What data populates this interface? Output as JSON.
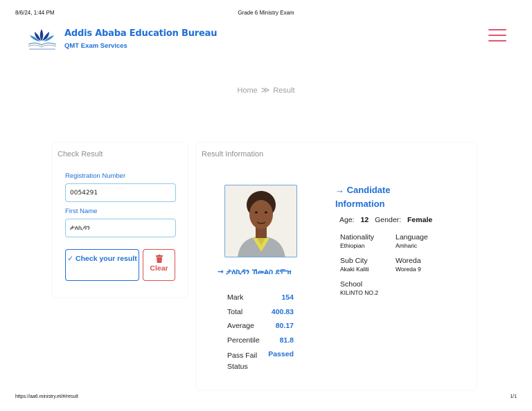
{
  "print": {
    "date": "8/6/24, 1:44 PM",
    "title": "Grade 6 Ministry Exam",
    "url": "https://aa6.ministry.et/#/result",
    "page": "1/1"
  },
  "brand": {
    "name": "Addis Ababa Education Bureau",
    "subtitle": "QMT Exam Services",
    "color": "#1f6fd6"
  },
  "breadcrumb": {
    "home": "Home",
    "separator": "≫",
    "current": "Result"
  },
  "check_result": {
    "title": "Check Result",
    "registration_label": "Registration Number",
    "registration_value": "0054291",
    "first_name_label": "First Name",
    "first_name_value": "ታለኪዳን",
    "check_button": "Check your result",
    "check_icon": "✓",
    "clear_button": "Clear",
    "clear_icon": "trash-icon"
  },
  "result": {
    "title": "Result Information",
    "candidate_name": "→ ታለኪዳን ኸመልስ ደሞዝ",
    "stats": [
      {
        "label": "Mark",
        "value": "154"
      },
      {
        "label": "Total",
        "value": "400.83"
      },
      {
        "label": "Average",
        "value": "80.17"
      },
      {
        "label": "Percentile",
        "value": "81.8"
      },
      {
        "label": "Pass Fail Status",
        "value": "Passed"
      }
    ]
  },
  "candidate_info": {
    "title": "→ Candidate Information",
    "age_label": "Age:",
    "age_value": "12",
    "gender_label": "Gender:",
    "gender_value": "Female",
    "nationality_label": "Nationality",
    "nationality_value": "Ethiopian",
    "language_label": "Language",
    "language_value": "Amharic",
    "subcity_label": "Sub City",
    "subcity_value": "Akaki Kaliti",
    "woreda_label": "Woreda",
    "woreda_value": "Woreda 9",
    "school_label": "School",
    "school_value": "KILINTO NO.2"
  },
  "colors": {
    "accent": "#1f6fd6",
    "hamburger": "#e05570",
    "danger": "#d9534f",
    "input_border": "#8ecae6"
  }
}
